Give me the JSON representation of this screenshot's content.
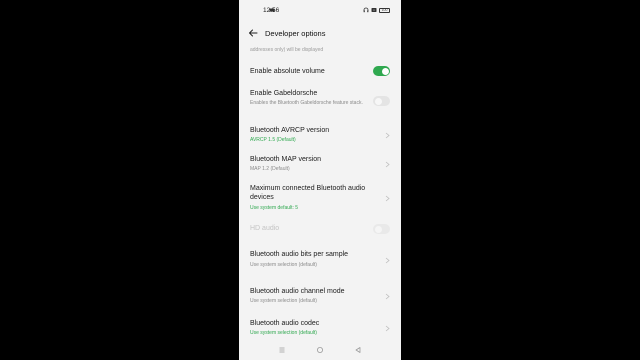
{
  "status": {
    "time": "12:56",
    "battery": "100"
  },
  "appbar": {
    "title": "Developer options"
  },
  "clipped_text": "addresses only) will be displayed",
  "items": [
    {
      "title": "Enable absolute volume",
      "subtitle": "",
      "control": "toggle-on"
    },
    {
      "title": "Enable Gabeldorsche",
      "subtitle": "Enables the Bluetooth Gabeldorsche feature stack.",
      "control": "toggle-off"
    },
    {
      "title": "Bluetooth AVRCP version",
      "subtitle": "AVRCP 1.5 (Default)",
      "subtitle_color": "green",
      "control": "chevron"
    },
    {
      "title": "Bluetooth MAP version",
      "subtitle": "MAP 1.2 (Default)",
      "control": "chevron"
    },
    {
      "title": "Maximum connected Bluetooth audio devices",
      "subtitle": "Use system default: 5",
      "subtitle_color": "green",
      "control": "chevron"
    },
    {
      "title": "HD audio",
      "subtitle": "",
      "control": "toggle-off",
      "disabled": true
    },
    {
      "title": "Bluetooth audio bits per sample",
      "subtitle": "Use system selection (default)",
      "control": "chevron"
    },
    {
      "title": "Bluetooth audio channel mode",
      "subtitle": "Use system selection (default)",
      "control": "chevron"
    },
    {
      "title": "Bluetooth audio codec",
      "subtitle": "Use system selection (default)",
      "subtitle_color": "green",
      "control": "chevron"
    }
  ],
  "navbar": {
    "icons": [
      "menu-icon",
      "home-icon",
      "back-triangle-icon"
    ]
  },
  "colors": {
    "accent": "#2fa84f",
    "background": "#f3f3f3"
  }
}
